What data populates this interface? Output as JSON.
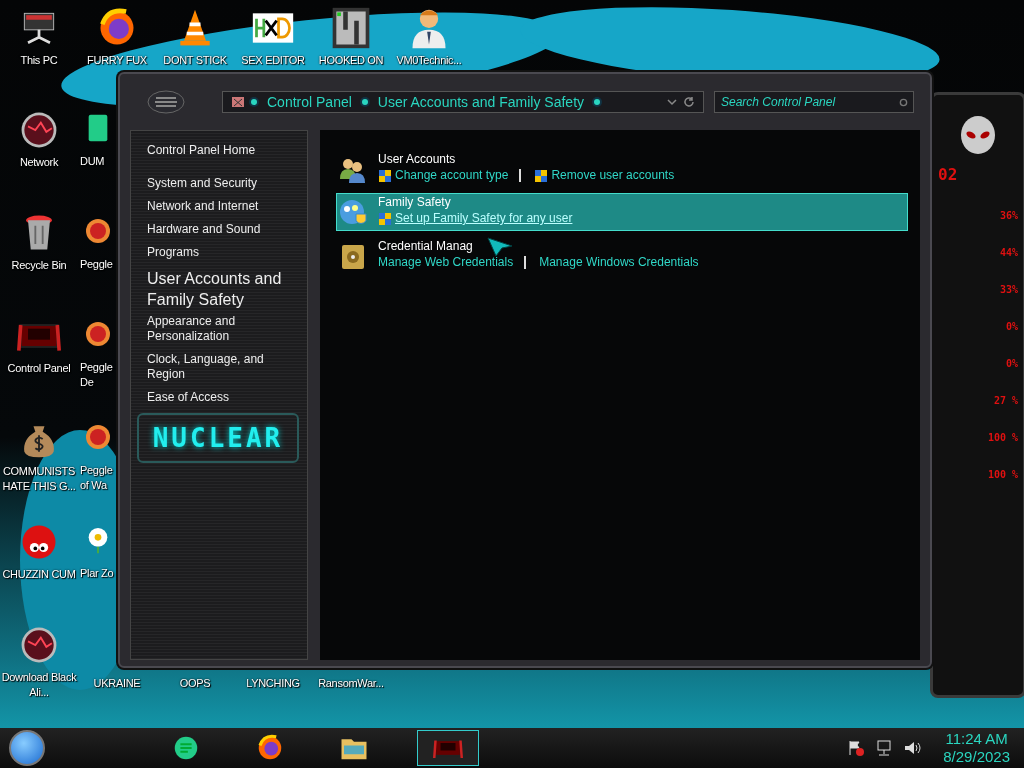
{
  "desktop": {
    "top_row": [
      {
        "label": "This PC",
        "kind": "monitor"
      },
      {
        "label": "FURRY FUX",
        "kind": "firefox"
      },
      {
        "label": "DONT STICK",
        "kind": "cone"
      },
      {
        "label": "SEX EDITOR",
        "kind": "hex"
      },
      {
        "label": "HOOKED ON",
        "kind": "maze"
      },
      {
        "label": "VM0Technic...",
        "kind": "person"
      }
    ],
    "left_column": [
      {
        "label": "Network",
        "kind": "orb"
      },
      {
        "label": "Recycle Bin",
        "kind": "bin"
      },
      {
        "label": "Control Panel",
        "kind": "panel"
      },
      {
        "label": "COMMUNISTS HATE THIS G...",
        "kind": "moneybag"
      },
      {
        "label": "CHUZZIN CUM",
        "kind": "fuzzball"
      },
      {
        "label": "Download Black Ali...",
        "kind": "orb"
      }
    ],
    "second_column": [
      {
        "label": "DUM",
        "kind": "green"
      },
      {
        "label": "Peggle",
        "kind": "peggle"
      },
      {
        "label": "Peggle De",
        "kind": "peggle"
      },
      {
        "label": "Peggle of Wa",
        "kind": "peggle"
      },
      {
        "label": "Plar Zo",
        "kind": "flower"
      }
    ],
    "bottom_row": [
      "UKRAINE",
      "OOPS",
      "LYNCHING",
      "RansomWar..."
    ]
  },
  "window": {
    "breadcrumb": [
      "Control Panel",
      "User Accounts and Family Safety"
    ],
    "search": {
      "placeholder": "Search Control Panel"
    },
    "sidebar": {
      "items": [
        {
          "label": "Control Panel Home",
          "current": false
        },
        {
          "label": "System and Security",
          "current": false
        },
        {
          "label": "Network and Internet",
          "current": false
        },
        {
          "label": "Hardware and Sound",
          "current": false
        },
        {
          "label": "Programs",
          "current": false
        },
        {
          "label": "User Accounts and Family Safety",
          "current": true
        },
        {
          "label": "Appearance and Personalization",
          "current": false
        },
        {
          "label": "Clock, Language, and Region",
          "current": false
        },
        {
          "label": "Ease of Access",
          "current": false
        }
      ],
      "logo": "NUCLEAR"
    },
    "categories": [
      {
        "title": "User Accounts",
        "kind": "users",
        "selected": false,
        "links": [
          {
            "label": "Change account type",
            "shield": true
          },
          {
            "label": "Remove user accounts",
            "shield": true
          }
        ]
      },
      {
        "title": "Family Safety",
        "kind": "family",
        "selected": true,
        "links": [
          {
            "label": "Set up Family Safety for any user",
            "shield": true
          }
        ]
      },
      {
        "title": "Credential Manag",
        "kind": "vault",
        "selected": false,
        "links": [
          {
            "label": "Manage Web Credentials",
            "shield": false
          },
          {
            "label": "Manage Windows Credentials",
            "shield": false
          }
        ]
      }
    ]
  },
  "gadget": {
    "readings": [
      "02",
      "36%",
      "44%",
      "33%",
      "0%",
      "0%",
      "27 %",
      "100 %",
      "100 %"
    ]
  },
  "taskbar": {
    "apps": [
      {
        "kind": "notes",
        "selected": false
      },
      {
        "kind": "firefox",
        "selected": false
      },
      {
        "kind": "folder",
        "selected": false
      },
      {
        "kind": "panel",
        "selected": true
      }
    ],
    "tray": [
      {
        "kind": "flag"
      },
      {
        "kind": "network"
      },
      {
        "kind": "volume"
      }
    ],
    "time": "11:24 AM",
    "date": "8/29/2023"
  }
}
